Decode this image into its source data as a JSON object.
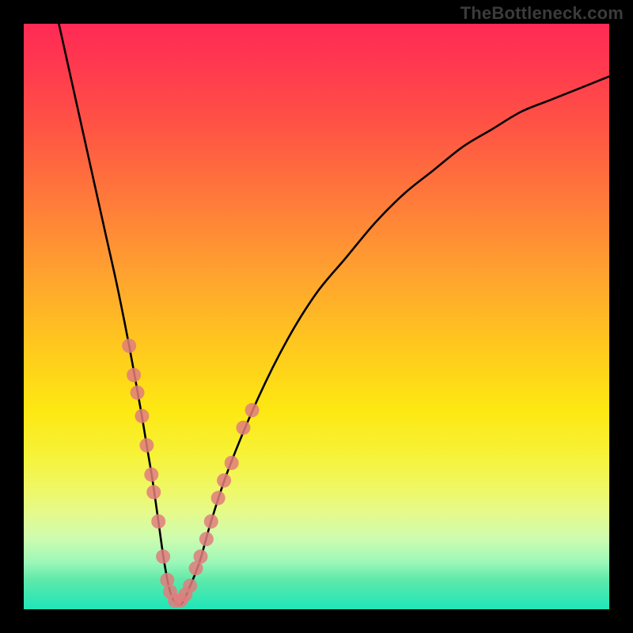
{
  "watermark": "TheBottleneck.com",
  "chart_data": {
    "type": "line",
    "title": "",
    "xlabel": "",
    "ylabel": "",
    "xlim": [
      0,
      100
    ],
    "ylim": [
      0,
      100
    ],
    "grid": false,
    "legend": false,
    "series": [
      {
        "name": "bottleneck-curve",
        "x": [
          6,
          8,
          10,
          12,
          14,
          16,
          18,
          20,
          21,
          22,
          23,
          24,
          25,
          26,
          27,
          28,
          30,
          32,
          35,
          40,
          45,
          50,
          55,
          60,
          65,
          70,
          75,
          80,
          85,
          90,
          95,
          100
        ],
        "y": [
          100,
          91,
          82,
          73,
          64,
          55,
          45,
          34,
          28,
          22,
          15,
          8,
          3,
          1,
          1,
          3,
          8,
          15,
          24,
          36,
          46,
          54,
          60,
          66,
          71,
          75,
          79,
          82,
          85,
          87,
          89,
          91
        ]
      }
    ],
    "markers": {
      "name": "highlight-points",
      "color": "#e07d7d",
      "points": [
        {
          "x": 18.0,
          "y": 45
        },
        {
          "x": 18.8,
          "y": 40
        },
        {
          "x": 19.4,
          "y": 37
        },
        {
          "x": 20.2,
          "y": 33
        },
        {
          "x": 21.0,
          "y": 28
        },
        {
          "x": 21.8,
          "y": 23
        },
        {
          "x": 22.2,
          "y": 20
        },
        {
          "x": 23.0,
          "y": 15
        },
        {
          "x": 23.8,
          "y": 9
        },
        {
          "x": 24.5,
          "y": 5
        },
        {
          "x": 25.0,
          "y": 3
        },
        {
          "x": 25.8,
          "y": 1.5
        },
        {
          "x": 26.8,
          "y": 1.5
        },
        {
          "x": 27.6,
          "y": 2.5
        },
        {
          "x": 28.4,
          "y": 4
        },
        {
          "x": 29.4,
          "y": 7
        },
        {
          "x": 30.2,
          "y": 9
        },
        {
          "x": 31.2,
          "y": 12
        },
        {
          "x": 32.0,
          "y": 15
        },
        {
          "x": 33.2,
          "y": 19
        },
        {
          "x": 34.2,
          "y": 22
        },
        {
          "x": 35.5,
          "y": 25
        },
        {
          "x": 37.5,
          "y": 31
        },
        {
          "x": 39.0,
          "y": 34
        }
      ]
    },
    "background": {
      "type": "vertical-gradient",
      "stops": [
        {
          "pos": 0.0,
          "color": "#ff2a55"
        },
        {
          "pos": 0.3,
          "color": "#ff7a3a"
        },
        {
          "pos": 0.6,
          "color": "#ffd81a"
        },
        {
          "pos": 0.8,
          "color": "#eef86a"
        },
        {
          "pos": 1.0,
          "color": "#1ee6b9"
        }
      ]
    }
  }
}
